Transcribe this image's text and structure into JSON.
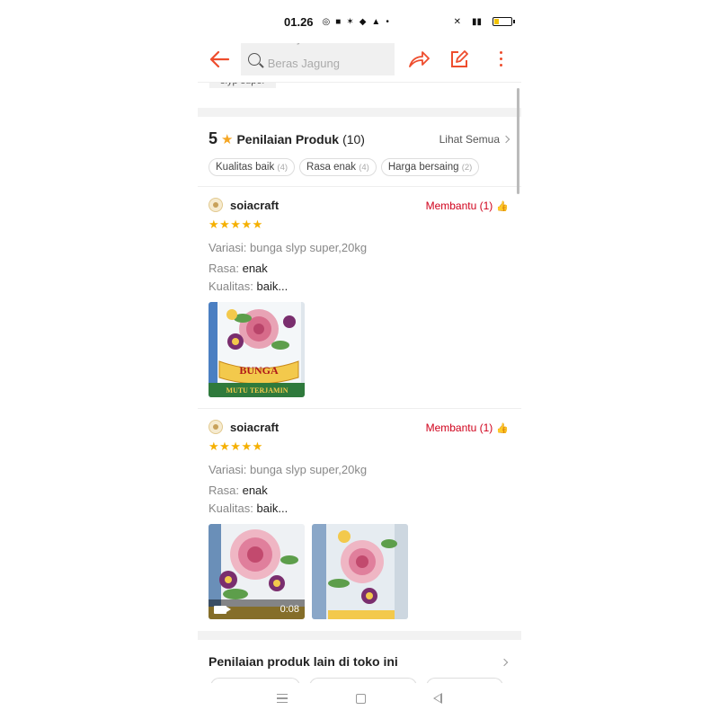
{
  "status_bar": {
    "time": "01.26",
    "battery_level": 0.3
  },
  "topbar": {
    "search_placeholder_line1": "Mie Ayam Mentah",
    "search_placeholder_line2": "Beras Jagung"
  },
  "scrolled_tag": "slyp super",
  "ratings": {
    "score": "5",
    "title": "Penilaian Produk",
    "count": "(10)",
    "see_all": "Lihat Semua",
    "chips": [
      {
        "label": "Kualitas baik",
        "count": "(4)"
      },
      {
        "label": "Rasa enak",
        "count": "(4)"
      },
      {
        "label": "Harga bersaing",
        "count": "(2)"
      }
    ]
  },
  "reviews": [
    {
      "username": "soiacraft",
      "helpful": "Membantu (1)",
      "stars": "★★★★★",
      "variation_key": "Variasi:",
      "variation_val": "bunga slyp super,20kg",
      "taste_key": "Rasa:",
      "taste_val": "enak",
      "quality_key": "Kualitas:",
      "quality_val": "baik...",
      "photo_label_1": "BUNGA",
      "photo_label_2": "MUTU TERJAMIN"
    },
    {
      "username": "soiacraft",
      "helpful": "Membantu (1)",
      "stars": "★★★★★",
      "variation_key": "Variasi:",
      "variation_val": "bunga slyp super,20kg",
      "taste_key": "Rasa:",
      "taste_val": "enak",
      "quality_key": "Kualitas:",
      "quality_val": "baik...",
      "video_duration": "0:08"
    }
  ],
  "other_reviews": {
    "title": "Penilaian produk lain di toko ini"
  },
  "colors": {
    "accent": "#ee4d2d",
    "star": "#f5b000",
    "helpful": "#d0011b"
  },
  "icons": [
    "back-arrow-icon",
    "search-icon",
    "share-icon",
    "edit-icon",
    "more-icon",
    "star-icon",
    "thumbs-up-icon",
    "video-camera-icon"
  ]
}
